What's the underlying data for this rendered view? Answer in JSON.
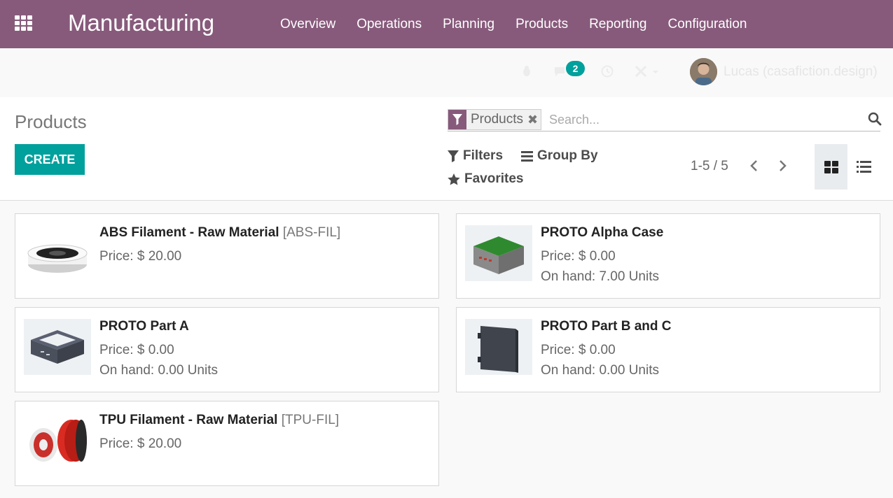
{
  "navbar": {
    "app_name": "Manufacturing",
    "menu": [
      "Overview",
      "Operations",
      "Planning",
      "Products",
      "Reporting",
      "Configuration"
    ]
  },
  "systray": {
    "messages_count": "2",
    "user_name": "Lucas (casafiction.design)"
  },
  "control_panel": {
    "title": "Products",
    "create_label": "CREATE",
    "search": {
      "facet_label": "Products",
      "placeholder": "Search..."
    },
    "filters_label": "Filters",
    "group_by_label": "Group By",
    "favorites_label": "Favorites",
    "pager": "1-5 / 5"
  },
  "products": [
    {
      "name": "ABS Filament - Raw Material",
      "ref": "[ABS-FIL]",
      "price": "Price: $ 20.00",
      "on_hand": ""
    },
    {
      "name": "PROTO Alpha Case",
      "ref": "",
      "price": "Price: $ 0.00",
      "on_hand": "On hand: 7.00 Units"
    },
    {
      "name": "PROTO Part A",
      "ref": "",
      "price": "Price: $ 0.00",
      "on_hand": "On hand: 0.00 Units"
    },
    {
      "name": "PROTO Part B and C",
      "ref": "",
      "price": "Price: $ 0.00",
      "on_hand": "On hand: 0.00 Units"
    },
    {
      "name": "TPU Filament - Raw Material",
      "ref": "[TPU-FIL]",
      "price": "Price: $ 20.00",
      "on_hand": ""
    }
  ],
  "colors": {
    "brand": "#875a7b",
    "accent": "#00a09d"
  },
  "icons": [
    "apps-grid-icon",
    "bug-icon",
    "chat-icon",
    "clock-icon",
    "tools-icon",
    "filter-icon",
    "close-icon",
    "search-icon",
    "bars-icon",
    "star-icon",
    "chevron-left-icon",
    "chevron-right-icon",
    "kanban-view-icon",
    "list-view-icon"
  ]
}
